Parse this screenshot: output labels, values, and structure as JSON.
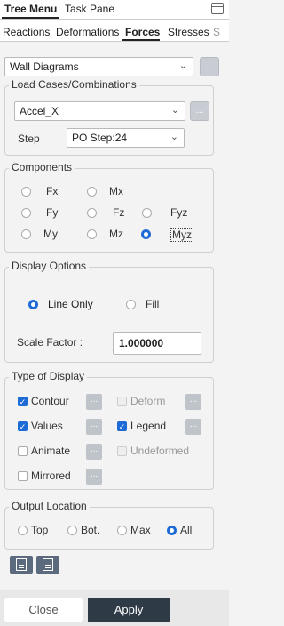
{
  "top_tabs": [
    "Tree Menu",
    "Task Pane"
  ],
  "sub_tabs": [
    "Reactions",
    "Deformations",
    "Forces",
    "Stresses",
    "S"
  ],
  "diagram_select": "Wall Diagrams",
  "dots": "...",
  "load_cases": {
    "title": "Load Cases/Combinations",
    "case": "Accel_X",
    "step_label": "Step",
    "step_value": "PO Step:24"
  },
  "components": {
    "title": "Components",
    "items": [
      "Fx",
      "Mx",
      "Fy",
      "Fz",
      "Fyz",
      "My",
      "Mz",
      "Myz"
    ],
    "selected": "Myz"
  },
  "display_options": {
    "title": "Display Options",
    "line_only": "Line Only",
    "fill": "Fill",
    "scale_label": "Scale Factor :",
    "scale_value": "1.000000"
  },
  "type_of_display": {
    "title": "Type of Display",
    "contour": "Contour",
    "deform": "Deform",
    "values": "Values",
    "legend": "Legend",
    "animate": "Animate",
    "undeformed": "Undeformed",
    "mirrored": "Mirrored"
  },
  "output_location": {
    "title": "Output Location",
    "options": [
      "Top",
      "Bot.",
      "Max",
      "All"
    ],
    "selected": "All"
  },
  "footer": {
    "close": "Close",
    "apply": "Apply"
  },
  "colors": {
    "accent": "#1e6bd6",
    "apply_bg": "#2f3a47"
  }
}
